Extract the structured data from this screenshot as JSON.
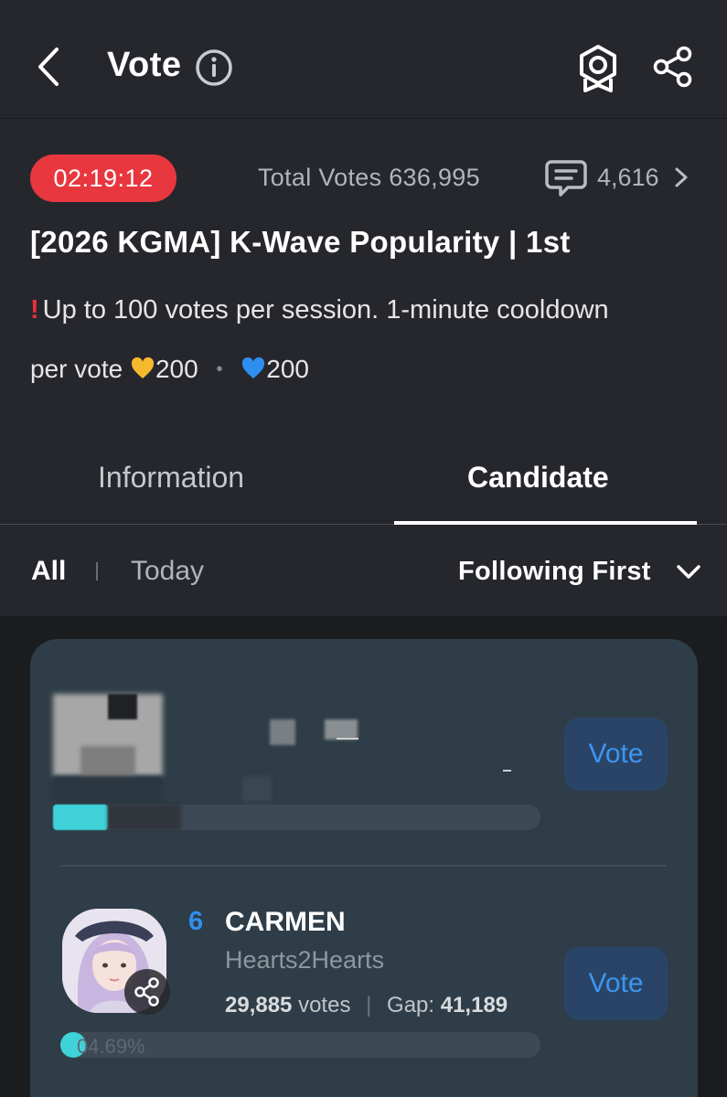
{
  "header": {
    "title": "Vote",
    "icons": [
      "back-arrow-icon",
      "info-icon",
      "award-badge-icon",
      "share-icon"
    ]
  },
  "summary": {
    "timer": "02:19:12",
    "total_votes": "Total Votes 636,995",
    "comment_count": "4,616",
    "title": "[2026 KGMA] K-Wave Popularity | 1st",
    "rule": "Up to 100 votes per session. 1-minute cooldown",
    "cost_prefix": "per vote",
    "gold_cost": "200",
    "blue_cost": "200",
    "colors": {
      "timer_bg": "#e8373f",
      "gold_heart": "#f5b92e",
      "blue_heart": "#2f8ff0"
    }
  },
  "tabs": {
    "information": "Information",
    "candidate": "Candidate",
    "active": "candidate"
  },
  "filters": {
    "all": "All",
    "today": "Today",
    "sort": "Following First"
  },
  "candidates": [
    {
      "vote_label": "Vote",
      "blurred": true
    },
    {
      "rank": "6",
      "name": "CARMEN",
      "group": "Hearts2Hearts",
      "votes_value": "29,885",
      "votes_unit": "votes",
      "gap_label": "Gap:",
      "gap_value": "41,189",
      "percent": "04.69%",
      "vote_label": "Vote",
      "bar_fill": 0.0469
    }
  ],
  "colors": {
    "accent_blue": "#2f8ff0",
    "bar_fill": "#3fd3d9",
    "card_bg": "#2e3d47"
  }
}
